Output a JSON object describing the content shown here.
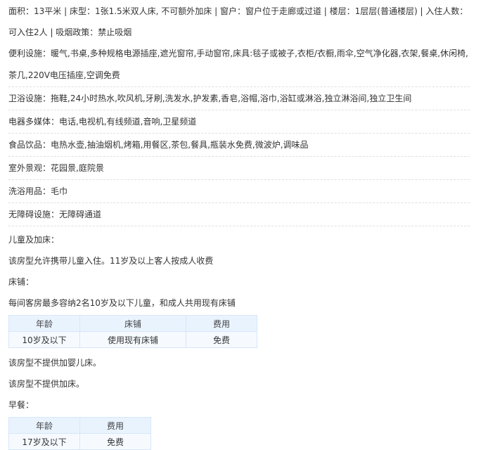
{
  "info": {
    "line1": "面积：13平米 | 床型：1张1.5米双人床, 不可额外加床 | 窗户：窗户位于走廊或过道 | 楼层：1层层(普通楼层) | 入住人数：",
    "line2": "可入住2人 | 吸烟政策：禁止吸烟"
  },
  "facilities": {
    "convenience_1": "便利设施：暖气,书桌,多种规格电源插座,遮光窗帘,手动窗帘,床具:毯子或被子,衣柜/衣橱,雨伞,空气净化器,衣架,餐桌,休闲椅,",
    "convenience_2": "茶几,220V电压插座,空调免费",
    "bathroom": "卫浴设施：拖鞋,24小时热水,吹风机,牙刷,洗发水,护发素,香皂,浴帽,浴巾,浴缸或淋浴,独立淋浴间,独立卫生间",
    "media": "电器多媒体：电话,电视机,有线频道,音响,卫星频道",
    "food": "食品饮品：电热水壶,抽油烟机,烤箱,用餐区,茶包,餐具,瓶装水免费,微波炉,调味品",
    "view": "室外景观：花园景,庭院景",
    "toiletries": "洗浴用品：毛巾",
    "accessibility": "无障碍设施：无障碍通道"
  },
  "children": {
    "heading": "儿童及加床：",
    "allow": "该房型允许携带儿童入住。11岁及以上客人按成人收费",
    "bed_heading": "床铺：",
    "bed_desc": "每间客房最多容纳2名10岁及以下儿童，和成人共用现有床铺",
    "bed_table": {
      "headers": [
        "年龄",
        "床铺",
        "费用"
      ],
      "rows": [
        [
          "10岁及以下",
          "使用现有床铺",
          "免费"
        ]
      ]
    },
    "crib": "该房型不提供加婴儿床。",
    "extra_bed": "该房型不提供加床。"
  },
  "breakfast": {
    "heading": "早餐：",
    "table": {
      "headers": [
        "年龄",
        "费用"
      ],
      "rows": [
        [
          "17岁及以下",
          "免费"
        ]
      ]
    }
  },
  "colors": {
    "link_free": "#1a7bd6",
    "table_header_bg": "#e9f3fe",
    "table_border": "#d6e6f8"
  }
}
